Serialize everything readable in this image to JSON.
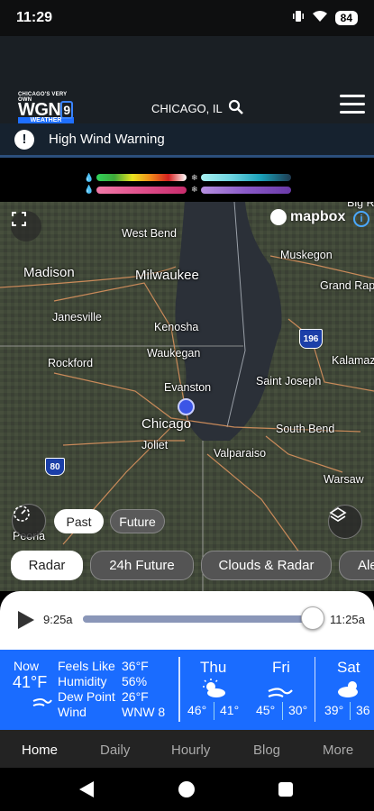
{
  "status": {
    "time": "11:29",
    "battery": "84"
  },
  "header": {
    "logo": {
      "top": "CHICAGO'S VERY OWN",
      "main": "WGN",
      "num": "9",
      "sub": "WEATHER"
    },
    "location": "CHICAGO, IL"
  },
  "alert": {
    "text": "High Wind Warning"
  },
  "map": {
    "attribution": "mapbox",
    "cities": {
      "big_rock": "Big Ra",
      "west_bend": "West Bend",
      "muskegon": "Muskegon",
      "madison": "Madison",
      "milwaukee": "Milwaukee",
      "grand_rapids": "Grand Rap",
      "janesville": "Janesville",
      "kenosha": "Kenosha",
      "waukegan": "Waukegan",
      "rockford": "Rockford",
      "kalamazoo": "Kalamaz",
      "evanston": "Evanston",
      "saint_joseph": "Saint Joseph",
      "chicago": "Chicago",
      "south_bend": "South Bend",
      "joliet": "Joliet",
      "valparaiso": "Valparaiso",
      "warsaw": "Warsaw",
      "peoria": "Peoria"
    },
    "shields": {
      "i196": "196",
      "i80": "80"
    }
  },
  "controls": {
    "past": "Past",
    "future": "Future",
    "tabs": [
      "Radar",
      "24h Future",
      "Clouds & Radar",
      "Ale"
    ]
  },
  "player": {
    "start": "9:25a",
    "end": "11:25a",
    "progress": 0.98
  },
  "current": {
    "now_label": "Now",
    "temp": "41°F",
    "feels_like_label": "Feels Like",
    "feels_like": "36°F",
    "humidity_label": "Humidity",
    "humidity": "56%",
    "dew_point_label": "Dew Point",
    "dew_point": "26°F",
    "wind_label": "Wind",
    "wind": "WNW 8"
  },
  "forecast": [
    {
      "day": "Thu",
      "hi": "46°",
      "lo": "41°",
      "icon": "partly-sunny-icon"
    },
    {
      "day": "Fri",
      "hi": "45°",
      "lo": "30°",
      "icon": "wind-icon"
    },
    {
      "day": "Sat",
      "hi": "39°",
      "lo": "36",
      "icon": "partly-cloudy-icon"
    }
  ],
  "nav": {
    "items": [
      "Home",
      "Daily",
      "Hourly",
      "Blog",
      "More"
    ]
  }
}
